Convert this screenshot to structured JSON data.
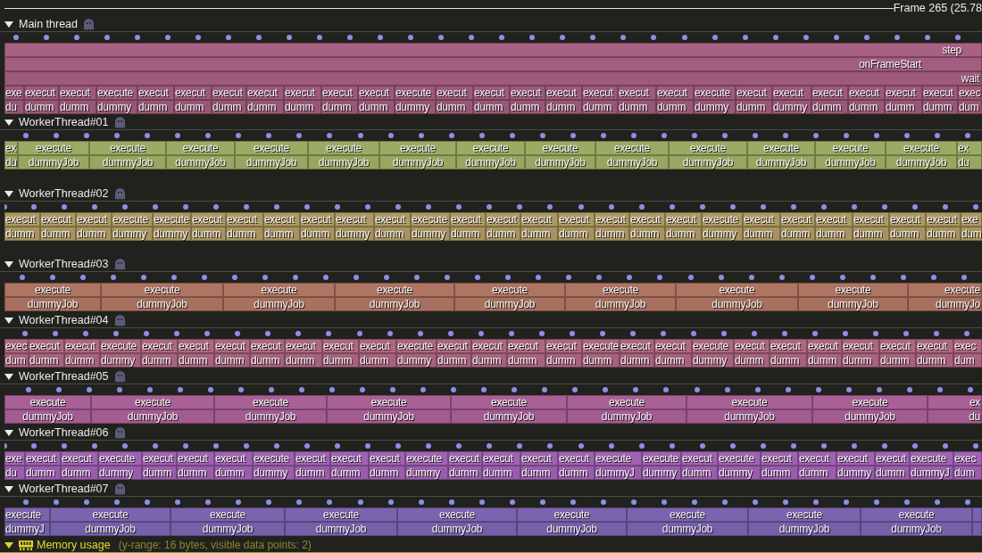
{
  "timeline": {
    "frame_label": "Frame 265 (25.78"
  },
  "threads": [
    {
      "name": "Main thread",
      "expanded": true,
      "zones": [
        {
          "label": "step",
          "children": [
            {
              "label": "onFrameStart",
              "children": [
                {
                  "label": "wait",
                  "children": [
                    {
                      "label": "exe",
                      "children": [
                        {
                          "label": "du"
                        }
                      ]
                    },
                    {
                      "label": "execut",
                      "children": [
                        {
                          "label": "dumm"
                        }
                      ]
                    },
                    {
                      "label": "execut",
                      "children": [
                        {
                          "label": "dumm"
                        }
                      ]
                    },
                    {
                      "label": "execute",
                      "children": [
                        {
                          "label": "dummy"
                        }
                      ]
                    },
                    {
                      "label": "execut",
                      "children": [
                        {
                          "label": "dumm"
                        }
                      ]
                    },
                    {
                      "label": "execut",
                      "children": [
                        {
                          "label": "dumm"
                        }
                      ]
                    },
                    {
                      "label": "execut",
                      "children": [
                        {
                          "label": "dumm"
                        }
                      ]
                    },
                    {
                      "label": "execut",
                      "children": [
                        {
                          "label": "dumm"
                        }
                      ]
                    },
                    {
                      "label": "execut",
                      "children": [
                        {
                          "label": "dumm"
                        }
                      ]
                    },
                    {
                      "label": "execut",
                      "children": [
                        {
                          "label": "dumm"
                        }
                      ]
                    },
                    {
                      "label": "execut",
                      "children": [
                        {
                          "label": "dumm"
                        }
                      ]
                    },
                    {
                      "label": "execute",
                      "children": [
                        {
                          "label": "dummy"
                        }
                      ]
                    },
                    {
                      "label": "execut",
                      "children": [
                        {
                          "label": "dumm"
                        }
                      ]
                    },
                    {
                      "label": "execut",
                      "children": [
                        {
                          "label": "dumm"
                        }
                      ]
                    },
                    {
                      "label": "execut",
                      "children": [
                        {
                          "label": "dumm"
                        }
                      ]
                    },
                    {
                      "label": "execut",
                      "children": [
                        {
                          "label": "dumm"
                        }
                      ]
                    },
                    {
                      "label": "execut",
                      "children": [
                        {
                          "label": "dumm"
                        }
                      ]
                    },
                    {
                      "label": "execut",
                      "children": [
                        {
                          "label": "dumm"
                        }
                      ]
                    },
                    {
                      "label": "execut",
                      "children": [
                        {
                          "label": "dumm"
                        }
                      ]
                    },
                    {
                      "label": "execute",
                      "children": [
                        {
                          "label": "dummy"
                        }
                      ]
                    },
                    {
                      "label": "execut",
                      "children": [
                        {
                          "label": "dumm"
                        }
                      ]
                    },
                    {
                      "label": "execut",
                      "children": [
                        {
                          "label": "dummy"
                        }
                      ]
                    },
                    {
                      "label": "execut",
                      "children": [
                        {
                          "label": "dumm"
                        }
                      ]
                    },
                    {
                      "label": "execut",
                      "children": [
                        {
                          "label": "dumm"
                        }
                      ]
                    },
                    {
                      "label": "execut",
                      "children": [
                        {
                          "label": "dumm"
                        }
                      ]
                    },
                    {
                      "label": "execut",
                      "children": [
                        {
                          "label": "dumm"
                        }
                      ]
                    },
                    {
                      "label": "exec",
                      "children": [
                        {
                          "label": "dum"
                        }
                      ]
                    }
                  ]
                }
              ]
            }
          ]
        }
      ]
    },
    {
      "name": "WorkerThread#01",
      "expanded": true,
      "zones": [
        {
          "label": "ex",
          "children": [
            {
              "label": "du"
            }
          ]
        },
        {
          "label": "execute",
          "children": [
            {
              "label": "dummyJob"
            }
          ]
        },
        {
          "label": "execute",
          "children": [
            {
              "label": "dummyJob"
            }
          ]
        },
        {
          "label": "execute",
          "children": [
            {
              "label": "dummyJob"
            }
          ]
        },
        {
          "label": "execute",
          "children": [
            {
              "label": "dummyJob"
            }
          ]
        },
        {
          "label": "execute",
          "children": [
            {
              "label": "dummyJob"
            }
          ]
        },
        {
          "label": "execute",
          "children": [
            {
              "label": "dummyJob"
            }
          ]
        },
        {
          "label": "execute",
          "children": [
            {
              "label": "dummyJob"
            }
          ]
        },
        {
          "label": "execute",
          "children": [
            {
              "label": "dummyJob"
            }
          ]
        },
        {
          "label": "execute",
          "children": [
            {
              "label": "dummyJob"
            }
          ]
        },
        {
          "label": "execute",
          "children": [
            {
              "label": "dummyJob"
            }
          ]
        },
        {
          "label": "execute",
          "children": [
            {
              "label": "dummyJob"
            }
          ]
        },
        {
          "label": "execute",
          "children": [
            {
              "label": "dummyJob"
            }
          ]
        },
        {
          "label": "execute",
          "children": [
            {
              "label": "dummyJob"
            }
          ]
        },
        {
          "label": "ex",
          "children": [
            {
              "label": "du"
            }
          ]
        }
      ]
    },
    {
      "name": "WorkerThread#02",
      "expanded": true,
      "zones": [
        {
          "label": "execut",
          "children": [
            {
              "label": "dumm"
            }
          ]
        },
        {
          "label": "execut",
          "children": [
            {
              "label": "dumm"
            }
          ]
        },
        {
          "label": "execut",
          "children": [
            {
              "label": "dumm"
            }
          ]
        },
        {
          "label": "execute",
          "children": [
            {
              "label": "dummy"
            }
          ]
        },
        {
          "label": "execute",
          "children": [
            {
              "label": "dummy"
            }
          ]
        },
        {
          "label": "execut",
          "children": [
            {
              "label": "dumm"
            }
          ]
        },
        {
          "label": "execut",
          "children": [
            {
              "label": "dumm"
            }
          ]
        },
        {
          "label": "execut",
          "children": [
            {
              "label": "dumm"
            }
          ]
        },
        {
          "label": "execut",
          "children": [
            {
              "label": "dumm"
            }
          ]
        },
        {
          "label": "execut",
          "children": [
            {
              "label": "dummy"
            }
          ]
        },
        {
          "label": "execut",
          "children": [
            {
              "label": "dumm"
            }
          ]
        },
        {
          "label": "execute",
          "children": [
            {
              "label": "dummy"
            }
          ]
        },
        {
          "label": "execut",
          "children": [
            {
              "label": "dumm"
            }
          ]
        },
        {
          "label": "execut",
          "children": [
            {
              "label": "dumm"
            }
          ]
        },
        {
          "label": "execut",
          "children": [
            {
              "label": "dumm"
            }
          ]
        },
        {
          "label": "execut",
          "children": [
            {
              "label": "dumm"
            }
          ]
        },
        {
          "label": "execut",
          "children": [
            {
              "label": "dumm"
            }
          ]
        },
        {
          "label": "execut",
          "children": [
            {
              "label": "dumm"
            }
          ]
        },
        {
          "label": "execut",
          "children": [
            {
              "label": "dumm"
            }
          ]
        },
        {
          "label": "execute",
          "children": [
            {
              "label": "dummy"
            }
          ]
        },
        {
          "label": "execut",
          "children": [
            {
              "label": "dumm"
            }
          ]
        },
        {
          "label": "execut",
          "children": [
            {
              "label": "dumm"
            }
          ]
        },
        {
          "label": "execut",
          "children": [
            {
              "label": "dumm"
            }
          ]
        },
        {
          "label": "execut",
          "children": [
            {
              "label": "dumm"
            }
          ]
        },
        {
          "label": "execut",
          "children": [
            {
              "label": "dumm"
            }
          ]
        },
        {
          "label": "execut",
          "children": [
            {
              "label": "dumm"
            }
          ]
        },
        {
          "label": "exe",
          "children": [
            {
              "label": "dum"
            }
          ]
        }
      ]
    },
    {
      "name": "WorkerThread#03",
      "expanded": true,
      "zones": [
        {
          "label": "execute",
          "children": [
            {
              "label": "dummyJob"
            }
          ]
        },
        {
          "label": "execute",
          "children": [
            {
              "label": "dummyJob"
            }
          ]
        },
        {
          "label": "execute",
          "children": [
            {
              "label": "dummyJob"
            }
          ]
        },
        {
          "label": "execute",
          "children": [
            {
              "label": "dummyJob"
            }
          ]
        },
        {
          "label": "execute",
          "children": [
            {
              "label": "dummyJob"
            }
          ]
        },
        {
          "label": "execute",
          "children": [
            {
              "label": "dummyJob"
            }
          ]
        },
        {
          "label": "execute",
          "children": [
            {
              "label": "dummyJob"
            }
          ]
        },
        {
          "label": "execute",
          "children": [
            {
              "label": "dummyJob"
            }
          ]
        },
        {
          "label": "execute",
          "children": [
            {
              "label": "dummyJo"
            }
          ]
        }
      ]
    },
    {
      "name": "WorkerThread#04",
      "expanded": true,
      "zones": [
        {
          "label": "exec",
          "children": [
            {
              "label": "dum"
            }
          ]
        },
        {
          "label": "execut",
          "children": [
            {
              "label": "dumm"
            }
          ]
        },
        {
          "label": "execut",
          "children": [
            {
              "label": "dumm"
            }
          ]
        },
        {
          "label": "execute",
          "children": [
            {
              "label": "dummy"
            }
          ]
        },
        {
          "label": "execut",
          "children": [
            {
              "label": "dumm"
            }
          ]
        },
        {
          "label": "execut",
          "children": [
            {
              "label": "dumm"
            }
          ]
        },
        {
          "label": "execut",
          "children": [
            {
              "label": "dumm"
            }
          ]
        },
        {
          "label": "execut",
          "children": [
            {
              "label": "dumm"
            }
          ]
        },
        {
          "label": "execut",
          "children": [
            {
              "label": "dumm"
            }
          ]
        },
        {
          "label": "execut",
          "children": [
            {
              "label": "dumm"
            }
          ]
        },
        {
          "label": "execut",
          "children": [
            {
              "label": "dumm"
            }
          ]
        },
        {
          "label": "execute",
          "children": [
            {
              "label": "dummy"
            }
          ]
        },
        {
          "label": "execut",
          "children": [
            {
              "label": "dumm"
            }
          ]
        },
        {
          "label": "execut",
          "children": [
            {
              "label": "dumm"
            }
          ]
        },
        {
          "label": "execut",
          "children": [
            {
              "label": "dumm"
            }
          ]
        },
        {
          "label": "execut",
          "children": [
            {
              "label": "dumm"
            }
          ]
        },
        {
          "label": "execute",
          "children": [
            {
              "label": "dumm"
            }
          ]
        },
        {
          "label": "execut",
          "children": [
            {
              "label": "dumm"
            }
          ]
        },
        {
          "label": "execut",
          "children": [
            {
              "label": "dumm"
            }
          ]
        },
        {
          "label": "execute",
          "children": [
            {
              "label": "dummy"
            }
          ]
        },
        {
          "label": "execut",
          "children": [
            {
              "label": "dumm"
            }
          ]
        },
        {
          "label": "execut",
          "children": [
            {
              "label": "dumm"
            }
          ]
        },
        {
          "label": "execut",
          "children": [
            {
              "label": "dumm"
            }
          ]
        },
        {
          "label": "execut",
          "children": [
            {
              "label": "dumm"
            }
          ]
        },
        {
          "label": "execut",
          "children": [
            {
              "label": "dumm"
            }
          ]
        },
        {
          "label": "execut",
          "children": [
            {
              "label": "dumm"
            }
          ]
        },
        {
          "label": "exec",
          "children": [
            {
              "label": "dum"
            }
          ]
        }
      ]
    },
    {
      "name": "WorkerThread#05",
      "expanded": true,
      "zones": [
        {
          "label": "execute",
          "children": [
            {
              "label": "dummyJob"
            }
          ]
        },
        {
          "label": "execute",
          "children": [
            {
              "label": "dummyJob"
            }
          ]
        },
        {
          "label": "execute",
          "children": [
            {
              "label": "dummyJob"
            }
          ]
        },
        {
          "label": "execute",
          "children": [
            {
              "label": "dummyJob"
            }
          ]
        },
        {
          "label": "execute",
          "children": [
            {
              "label": "dummyJob"
            }
          ]
        },
        {
          "label": "execute",
          "children": [
            {
              "label": "dummyJob"
            }
          ]
        },
        {
          "label": "execute",
          "children": [
            {
              "label": "dummyJob"
            }
          ]
        },
        {
          "label": "execute",
          "children": [
            {
              "label": "dummyJob"
            }
          ]
        },
        {
          "label": "ex",
          "children": [
            {
              "label": "du"
            }
          ]
        }
      ]
    },
    {
      "name": "WorkerThread#06",
      "expanded": true,
      "zones": [
        {
          "label": "exe",
          "children": [
            {
              "label": "du"
            }
          ]
        },
        {
          "label": "execut",
          "children": [
            {
              "label": "dumm"
            }
          ]
        },
        {
          "label": "execut",
          "children": [
            {
              "label": "dumm"
            }
          ]
        },
        {
          "label": "execute",
          "children": [
            {
              "label": "dummy"
            }
          ]
        },
        {
          "label": "execut",
          "children": [
            {
              "label": "dumm"
            }
          ]
        },
        {
          "label": "execut",
          "children": [
            {
              "label": "dumm"
            }
          ]
        },
        {
          "label": "execut",
          "children": [
            {
              "label": "dumm"
            }
          ]
        },
        {
          "label": "execute",
          "children": [
            {
              "label": "dummy"
            }
          ]
        },
        {
          "label": "execut",
          "children": [
            {
              "label": "dumm"
            }
          ]
        },
        {
          "label": "execut",
          "children": [
            {
              "label": "dumm"
            }
          ]
        },
        {
          "label": "execut",
          "children": [
            {
              "label": "dumm"
            }
          ]
        },
        {
          "label": "execute",
          "children": [
            {
              "label": "dummy"
            }
          ]
        },
        {
          "label": "execut",
          "children": [
            {
              "label": "dumm"
            }
          ]
        },
        {
          "label": "execut",
          "children": [
            {
              "label": "dumm"
            }
          ]
        },
        {
          "label": "execut",
          "children": [
            {
              "label": "dumm"
            }
          ]
        },
        {
          "label": "execut",
          "children": [
            {
              "label": "dumm"
            }
          ]
        },
        {
          "label": "execute",
          "children": [
            {
              "label": "dummyJ"
            }
          ]
        },
        {
          "label": "execute",
          "children": [
            {
              "label": "dummy"
            }
          ]
        },
        {
          "label": "execut",
          "children": [
            {
              "label": "dumm"
            }
          ]
        },
        {
          "label": "execute",
          "children": [
            {
              "label": "dummy"
            }
          ]
        },
        {
          "label": "execut",
          "children": [
            {
              "label": "dumm"
            }
          ]
        },
        {
          "label": "execut",
          "children": [
            {
              "label": "dumm"
            }
          ]
        },
        {
          "label": "execut",
          "children": [
            {
              "label": "dummy"
            }
          ]
        },
        {
          "label": "execut",
          "children": [
            {
              "label": "dumm"
            }
          ]
        },
        {
          "label": "execute",
          "children": [
            {
              "label": "dummyJ"
            }
          ]
        },
        {
          "label": "exec",
          "children": [
            {
              "label": "dum"
            }
          ]
        }
      ]
    },
    {
      "name": "WorkerThread#07",
      "expanded": true,
      "zones": [
        {
          "label": "execute",
          "children": [
            {
              "label": "dummyJ"
            }
          ]
        },
        {
          "label": "execute",
          "children": [
            {
              "label": "dummyJob"
            }
          ]
        },
        {
          "label": "execute",
          "children": [
            {
              "label": "dummyJob"
            }
          ]
        },
        {
          "label": "execute",
          "children": [
            {
              "label": "dummyJob"
            }
          ]
        },
        {
          "label": "execute",
          "children": [
            {
              "label": "dummyJob"
            }
          ]
        },
        {
          "label": "execute",
          "children": [
            {
              "label": "dummyJob"
            }
          ]
        },
        {
          "label": "execute",
          "children": [
            {
              "label": "dummyJob"
            }
          ]
        },
        {
          "label": "execute",
          "children": [
            {
              "label": "dummyJob"
            }
          ]
        },
        {
          "label": "execute",
          "children": [
            {
              "label": "dummyJob"
            }
          ]
        },
        {
          "kind": "sliver"
        }
      ]
    }
  ],
  "plots": [
    {
      "name": "Memory usage",
      "expanded": true,
      "info": "(y-range: 16 bytes, visible data points: 2)"
    }
  ]
}
